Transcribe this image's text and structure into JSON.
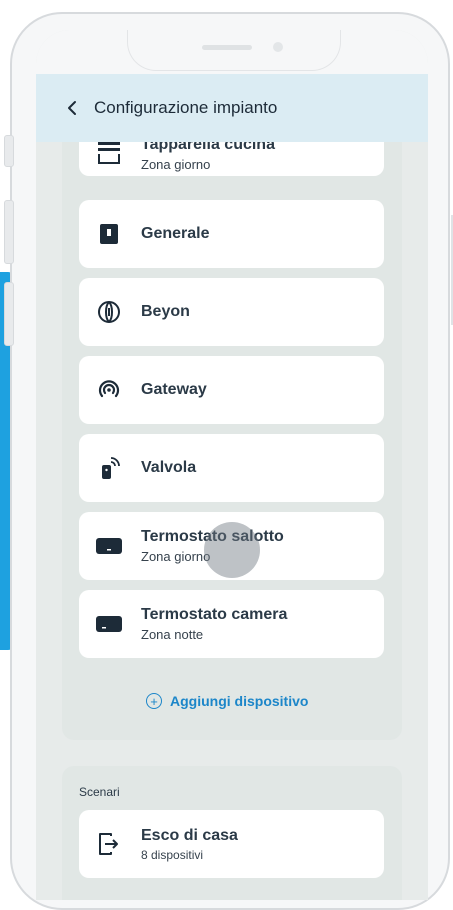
{
  "header": {
    "title": "Configurazione impianto"
  },
  "devices": [
    {
      "name": "Tapparella cucina",
      "zone": "Zona giorno",
      "icon": "shutter-icon"
    },
    {
      "name": "Generale",
      "zone": "",
      "icon": "switch-icon"
    },
    {
      "name": "Beyon",
      "zone": "",
      "icon": "beyon-icon"
    },
    {
      "name": "Gateway",
      "zone": "",
      "icon": "gateway-icon"
    },
    {
      "name": "Valvola",
      "zone": "",
      "icon": "valve-icon"
    },
    {
      "name": "Termostato salotto",
      "zone": "Zona giorno",
      "icon": "thermostat-icon"
    },
    {
      "name": "Termostato camera",
      "zone": "Zona notte",
      "icon": "thermostat-icon"
    }
  ],
  "add_device": {
    "label": "Aggiungi dispositivo"
  },
  "scenarios": {
    "section_label": "Scenari",
    "items": [
      {
        "name": "Esco di casa",
        "count": "8 dispositivi",
        "icon": "exit-icon"
      }
    ]
  },
  "colors": {
    "accent": "#1c86c9",
    "header_bg": "#dbecf3",
    "panel_bg": "#e1e7e5"
  }
}
